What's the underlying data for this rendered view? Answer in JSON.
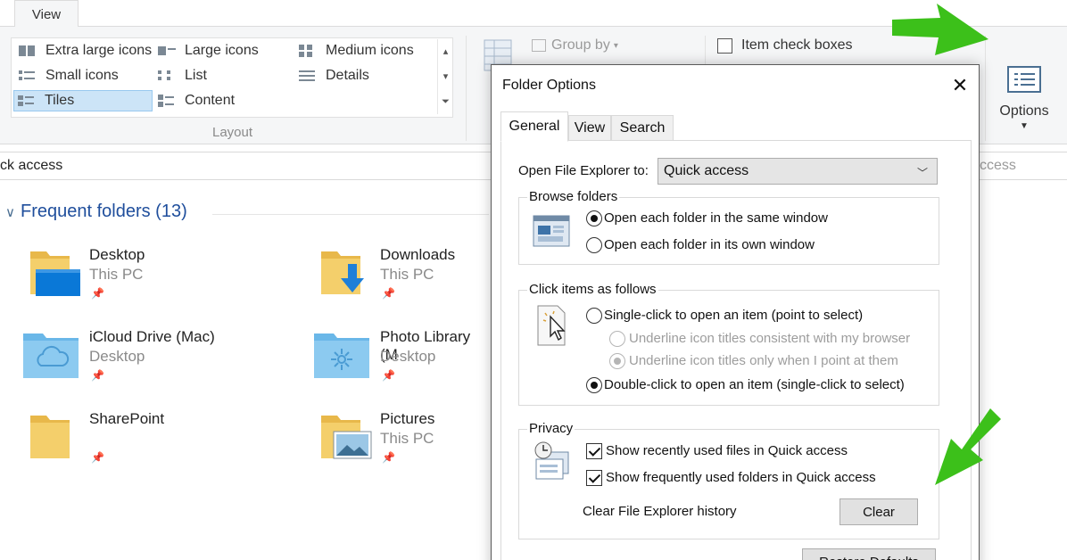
{
  "ribbon": {
    "tab_view": "View",
    "layout": {
      "items": [
        {
          "label": "Extra large icons",
          "icon": "extra-large-icons-icon"
        },
        {
          "label": "Large icons",
          "icon": "large-icons-icon"
        },
        {
          "label": "Medium icons",
          "icon": "medium-icons-icon"
        },
        {
          "label": "Small icons",
          "icon": "small-icons-icon"
        },
        {
          "label": "List",
          "icon": "list-icon"
        },
        {
          "label": "Details",
          "icon": "details-icon"
        },
        {
          "label": "Tiles",
          "icon": "tiles-icon",
          "selected": true
        },
        {
          "label": "Content",
          "icon": "content-icon"
        }
      ],
      "group_label": "Layout"
    },
    "group_by": "Group by",
    "item_check_boxes": "Item check boxes",
    "options_label": "Options"
  },
  "address": {
    "path": "ck access",
    "search_fragment": "ccess"
  },
  "frequent": {
    "header": "Frequent folders (13)",
    "folders": [
      {
        "name": "Desktop",
        "location": "This PC",
        "icon": "desktop-folder-icon"
      },
      {
        "name": "Downloads",
        "location": "This PC",
        "icon": "downloads-folder-icon"
      },
      {
        "name": "iCloud Drive (Mac)",
        "location": "Desktop",
        "icon": "icloud-folder-icon"
      },
      {
        "name": "Photo Library (M",
        "location": "Desktop",
        "icon": "photo-library-folder-icon"
      },
      {
        "name": "SharePoint",
        "location": "",
        "icon": "folder-icon"
      },
      {
        "name": "Pictures",
        "location": "This PC",
        "icon": "pictures-folder-icon"
      }
    ],
    "pin_glyph": "📌"
  },
  "dialog": {
    "title": "Folder Options",
    "close": "✕",
    "tabs": [
      "General",
      "View",
      "Search"
    ],
    "active_tab": "General",
    "open_explorer_label": "Open File Explorer to:",
    "open_explorer_value": "Quick access",
    "browse": {
      "title": "Browse folders",
      "options": [
        "Open each folder in the same window",
        "Open each folder in its own window"
      ],
      "selected": 0
    },
    "click": {
      "title": "Click items as follows",
      "single": "Single-click to open an item (point to select)",
      "underline_consistent": "Underline icon titles consistent with my browser",
      "underline_point": "Underline icon titles only when I point at them",
      "double": "Double-click to open an item (single-click to select)",
      "selected": "double"
    },
    "privacy": {
      "title": "Privacy",
      "recent_files": "Show recently used files in Quick access",
      "frequent_folders": "Show frequently used folders in Quick access",
      "recent_checked": true,
      "frequent_checked": true,
      "clear_history_label": "Clear File Explorer history",
      "clear_button": "Clear"
    },
    "restore_defaults": "Restore Defaults"
  },
  "colors": {
    "annotation_arrow": "#3cc01a",
    "accent_blue": "#1f4e9c",
    "selection": "#cce4f7"
  }
}
